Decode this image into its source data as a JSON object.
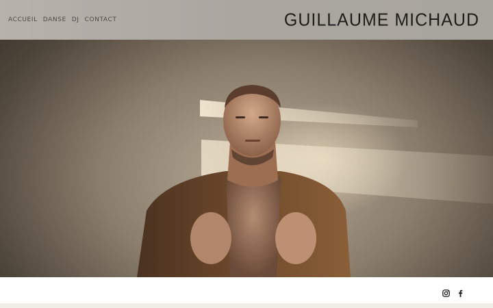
{
  "nav": {
    "items": [
      {
        "label": "ACCUEIL"
      },
      {
        "label": "DANSE"
      },
      {
        "label": "DJ"
      },
      {
        "label": "CONTACT"
      }
    ]
  },
  "logo": {
    "text": "GUILLAUME MICHAUD"
  },
  "hero": {
    "image": "portrait-photo"
  },
  "social": {
    "icons": [
      "instagram-icon",
      "facebook-icon"
    ]
  },
  "colors": {
    "header_bg": "#aaa69f",
    "nav_text": "#4a4844",
    "logo_text": "#1f1d1a",
    "bottom_strip": "#f1efe5"
  }
}
